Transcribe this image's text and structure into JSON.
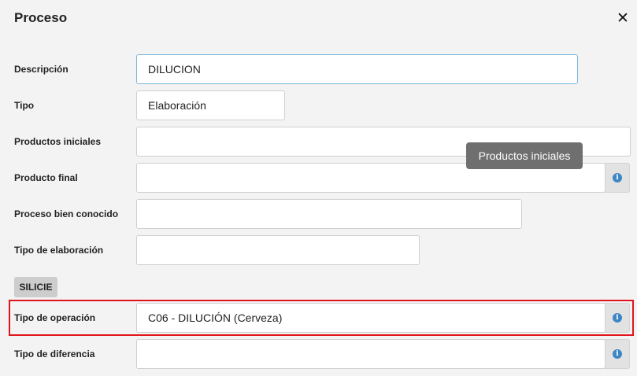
{
  "dialog": {
    "title": "Proceso",
    "close_label": "✕"
  },
  "fields": {
    "descripcion": {
      "label": "Descripción",
      "value": "DILUCION"
    },
    "tipo": {
      "label": "Tipo",
      "value": "Elaboración"
    },
    "productos_iniciales": {
      "label": "Productos iniciales",
      "value": ""
    },
    "producto_final": {
      "label": "Producto final",
      "value": ""
    },
    "proceso_bien_conocido": {
      "label": "Proceso bien conocido",
      "value": ""
    },
    "tipo_elaboracion": {
      "label": "Tipo de elaboración",
      "value": ""
    },
    "tipo_operacion": {
      "label": "Tipo de operación",
      "value": "C06 - DILUCIÓN (Cerveza)"
    },
    "tipo_diferencia": {
      "label": "Tipo de diferencia",
      "value": ""
    }
  },
  "section": {
    "label": "SILICIE"
  },
  "tooltip": {
    "text": "Productos iniciales"
  },
  "icons": {
    "info": "info-icon",
    "close": "close-icon"
  },
  "colors": {
    "info_icon": "#3d86c6",
    "highlight": "#e0141c",
    "focus_border": "#7cb6dc"
  }
}
